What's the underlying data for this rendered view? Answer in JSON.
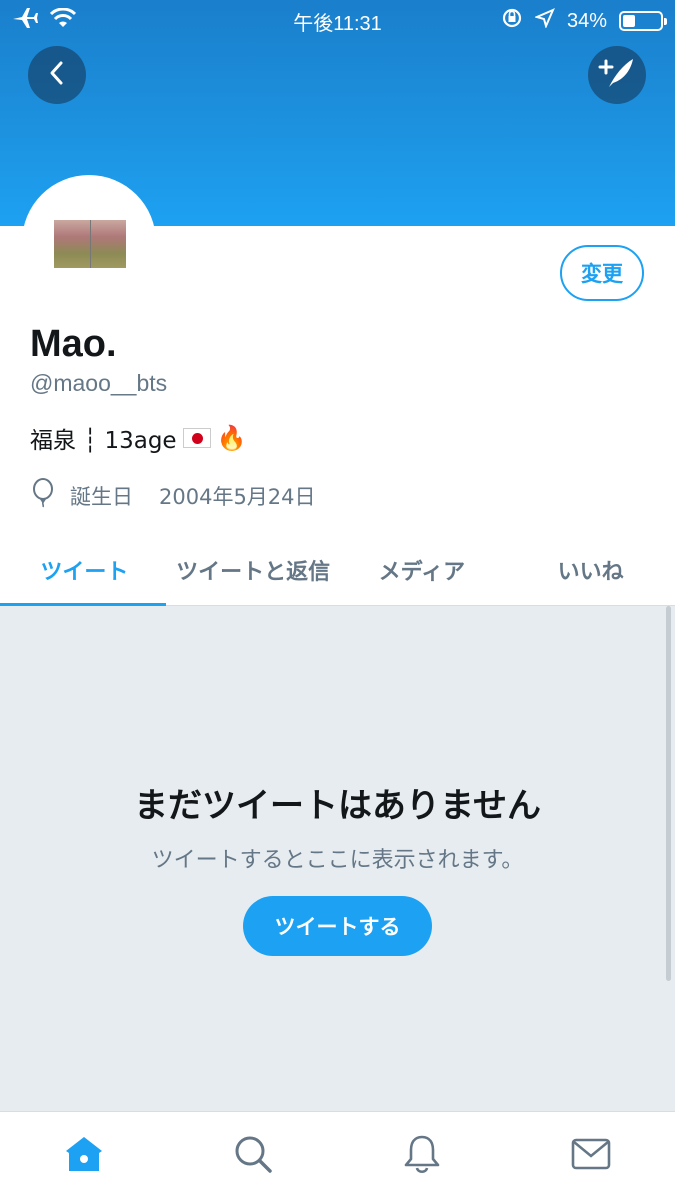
{
  "status_bar": {
    "time": "午後11:31",
    "battery_percent_label": "34%",
    "battery_level": 0.34,
    "icons": [
      "airplane-icon",
      "wifi-icon",
      "orientation-lock-icon",
      "location-icon",
      "battery-icon"
    ]
  },
  "header": {
    "back_icon": "chevron-left-icon",
    "compose_icon": "compose-tweet-icon"
  },
  "profile": {
    "edit_label": "変更",
    "name": "Mao.",
    "handle": "@maoo__bts",
    "bio_text": "福泉 ┆ 13age",
    "bio_emoji": [
      "japan-flag",
      "fire"
    ],
    "birthday_label": "誕生日",
    "birthday_value": "2004年5月24日"
  },
  "tabs": [
    {
      "label": "ツイート",
      "active": true
    },
    {
      "label": "ツイートと返信",
      "active": false
    },
    {
      "label": "メディア",
      "active": false
    },
    {
      "label": "いいね",
      "active": false
    }
  ],
  "empty_state": {
    "title": "まだツイートはありません",
    "subtitle": "ツイートするとここに表示されます。",
    "button_label": "ツイートする"
  },
  "bottom_nav": [
    "home-icon",
    "search-icon",
    "notifications-icon",
    "messages-icon"
  ],
  "colors": {
    "accent": "#1da1f2",
    "secondary_text": "#657786",
    "empty_bg": "#e6ecf0"
  }
}
